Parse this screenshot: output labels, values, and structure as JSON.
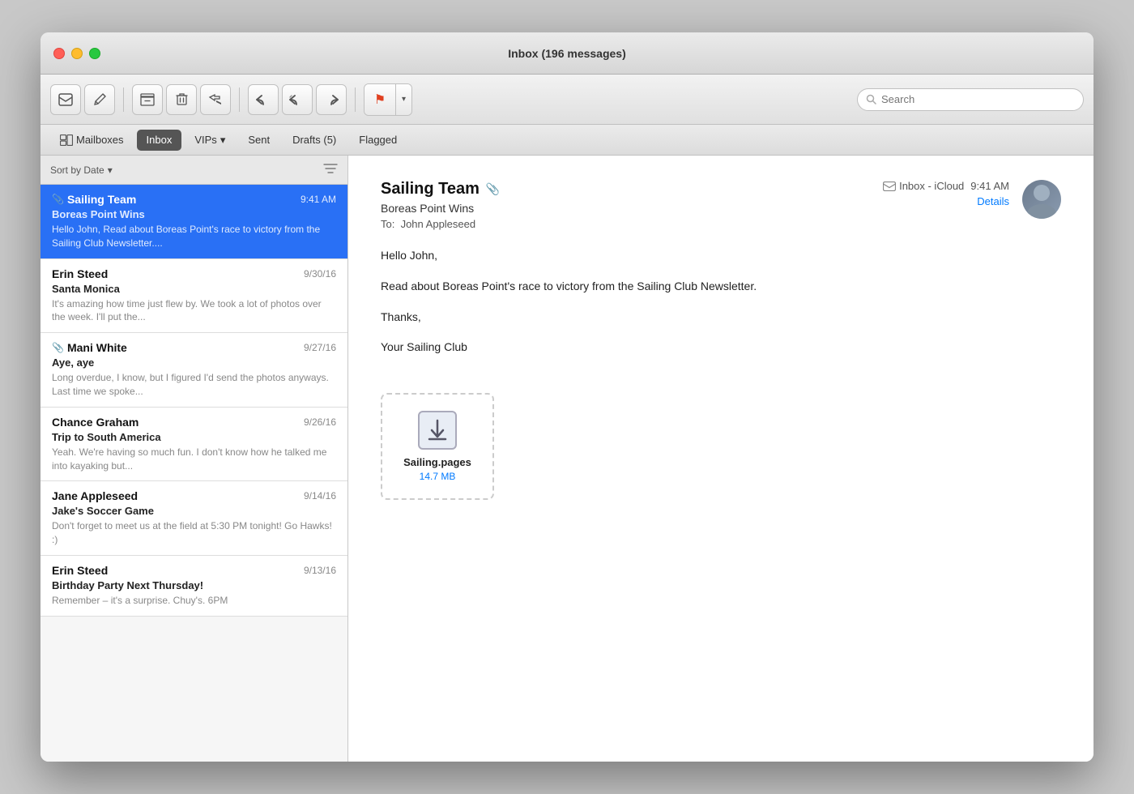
{
  "window": {
    "title": "Inbox (196 messages)"
  },
  "toolbar": {
    "new_message_label": "✉",
    "compose_label": "✏",
    "archive_label": "▦",
    "trash_label": "🗑",
    "reply_later_label": "⏩",
    "reply_label": "←",
    "reply_all_label": "«",
    "forward_label": "→",
    "flag_label": "⚑",
    "search_placeholder": "Search"
  },
  "nav": {
    "mailboxes_label": "Mailboxes",
    "inbox_label": "Inbox",
    "vips_label": "VIPs",
    "sent_label": "Sent",
    "drafts_label": "Drafts (5)",
    "flagged_label": "Flagged"
  },
  "sort_bar": {
    "sort_label": "Sort by Date",
    "sort_arrow": "▾"
  },
  "messages": [
    {
      "sender": "Sailing Team",
      "date": "9:41 AM",
      "subject": "Boreas Point Wins",
      "preview": "Hello John, Read about Boreas Point's race to victory from the Sailing Club Newsletter....",
      "has_attachment": true,
      "selected": true
    },
    {
      "sender": "Erin Steed",
      "date": "9/30/16",
      "subject": "Santa Monica",
      "preview": "It's amazing how time just flew by. We took a lot of photos over the week. I'll put the...",
      "has_attachment": false,
      "selected": false
    },
    {
      "sender": "Mani White",
      "date": "9/27/16",
      "subject": "Aye, aye",
      "preview": "Long overdue, I know, but I figured I'd send the photos anyways. Last time we spoke...",
      "has_attachment": true,
      "selected": false
    },
    {
      "sender": "Chance Graham",
      "date": "9/26/16",
      "subject": "Trip to South America",
      "preview": "Yeah. We're having so much fun. I don't know how he talked me into kayaking but...",
      "has_attachment": false,
      "selected": false
    },
    {
      "sender": "Jane Appleseed",
      "date": "9/14/16",
      "subject": "Jake's Soccer Game",
      "preview": "Don't forget to meet us at the field at 5:30 PM tonight! Go Hawks! :)",
      "has_attachment": false,
      "selected": false
    },
    {
      "sender": "Erin Steed",
      "date": "9/13/16",
      "subject": "Birthday Party Next Thursday!",
      "preview": "Remember – it's a surprise. Chuy's. 6PM",
      "has_attachment": false,
      "selected": false
    }
  ],
  "email_detail": {
    "from": "Sailing Team",
    "attachment_icon": "📎",
    "mailbox": "Inbox - iCloud",
    "time": "9:41 AM",
    "details_label": "Details",
    "subject": "Boreas Point Wins",
    "to_label": "To:",
    "to": "John Appleseed",
    "body_lines": [
      "Hello John,",
      "Read about Boreas Point's race to victory from the Sailing Club Newsletter.",
      "Thanks,",
      "Your Sailing Club"
    ],
    "attachment": {
      "name": "Sailing.pages",
      "size": "14.7 MB"
    }
  }
}
